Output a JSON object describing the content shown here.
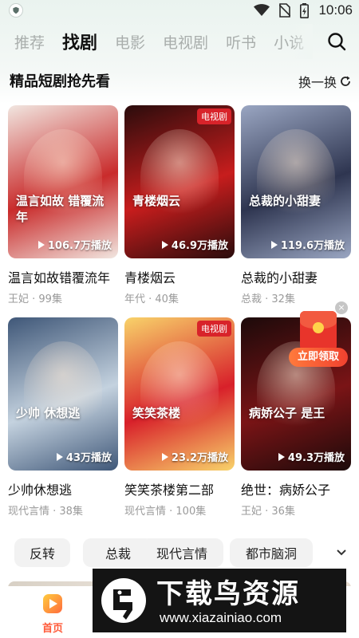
{
  "status_bar": {
    "time": "10:06",
    "icons": [
      "shield-icon",
      "wifi-icon",
      "no-sim-icon",
      "battery-icon"
    ]
  },
  "top_tabs": {
    "items": [
      {
        "label": "推荐",
        "active": false
      },
      {
        "label": "找剧",
        "active": true
      },
      {
        "label": "电影",
        "active": false
      },
      {
        "label": "电视剧",
        "active": false
      },
      {
        "label": "听书",
        "active": false
      },
      {
        "label": "小说",
        "active": false
      }
    ],
    "search_icon": "search-icon"
  },
  "section": {
    "title": "精品短剧抢先看",
    "refresh_label": "换一换",
    "refresh_icon": "refresh-icon"
  },
  "cards": [
    {
      "title": "温言如故错覆流年",
      "sub": "王妃 · 99集",
      "plays": "106.7万播放",
      "poster_text": "温言如故 错覆流年",
      "badge": "",
      "colors": [
        "#c92b2b",
        "#f1e6e0"
      ]
    },
    {
      "title": "青楼烟云",
      "sub": "年代 · 40集",
      "plays": "46.9万播放",
      "poster_text": "青楼烟云",
      "badge": "电视剧",
      "colors": [
        "#c71d1d",
        "#2a0c0c"
      ]
    },
    {
      "title": "总裁的小甜妻",
      "sub": "总裁 · 32集",
      "plays": "119.6万播放",
      "poster_text": "总裁的小甜妻",
      "badge": "",
      "colors": [
        "#2e3550",
        "#9aa6c2"
      ]
    },
    {
      "title": "少帅休想逃",
      "sub": "现代言情 · 38集",
      "plays": "43万播放",
      "poster_text": "少帅 休想逃",
      "badge": "",
      "colors": [
        "#c4d2df",
        "#3f5778"
      ]
    },
    {
      "title": "笑笑茶楼第二部",
      "sub": "现代言情 · 100集",
      "plays": "23.2万播放",
      "poster_text": "笑笑茶楼",
      "badge": "电视剧",
      "colors": [
        "#d8202a",
        "#f8d36a"
      ]
    },
    {
      "title": "绝世：病娇公子",
      "sub": "王妃 · 36集",
      "plays": "49.3万播放",
      "poster_text": "病娇公子 是王",
      "badge": "",
      "colors": [
        "#7a1416",
        "#1c0a0a"
      ]
    }
  ],
  "red_packet": {
    "label": "立即领取",
    "close": "×"
  },
  "chips": {
    "items": [
      "反转",
      "总裁",
      "现代言情",
      "都市脑洞"
    ],
    "more_icon": "chevron-down-icon"
  },
  "bottom_nav": {
    "home_label": "首页"
  },
  "watermark": {
    "title": "下载鸟资源",
    "url": "www.xiazainiao.com"
  }
}
